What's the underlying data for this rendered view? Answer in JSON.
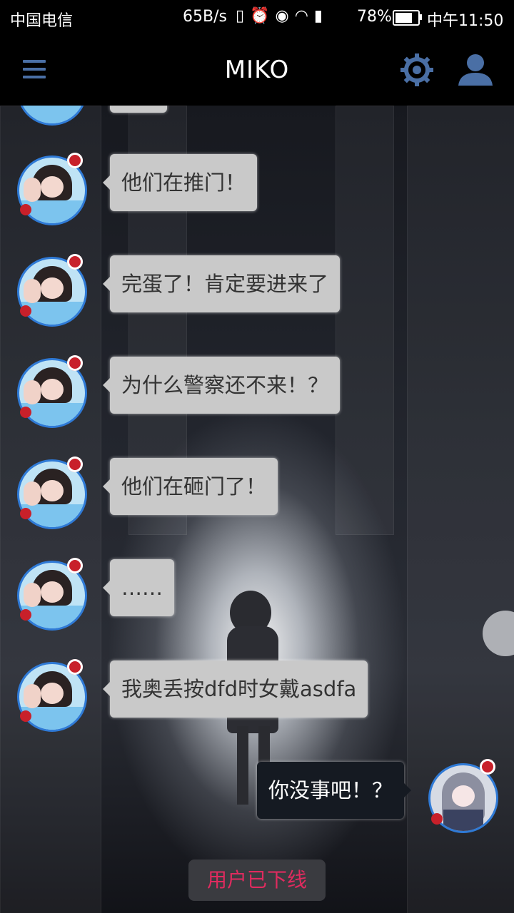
{
  "status_bar": {
    "carrier": "中国电信",
    "speed": "65B/s",
    "battery_percent": "78%",
    "battery_level": 0.78,
    "time": "中午11:50"
  },
  "header": {
    "title": "MIKO",
    "menu_icon": "menu-icon",
    "settings_icon": "gear-icon",
    "profile_icon": "user-icon",
    "accent_color": "#4a6fa5"
  },
  "messages": [
    {
      "sender": "miko",
      "text": "他们在推门！"
    },
    {
      "sender": "miko",
      "text": "完蛋了！肯定要进来了"
    },
    {
      "sender": "miko",
      "text": "为什么警察还不来！？"
    },
    {
      "sender": "miko",
      "text": "他们在砸门了！"
    },
    {
      "sender": "miko",
      "text": "……"
    },
    {
      "sender": "miko",
      "text": "我奥丢按dfd时女戴asdfa"
    },
    {
      "sender": "user",
      "text": "你没事吧！？"
    }
  ],
  "status_notice": "用户已下线"
}
